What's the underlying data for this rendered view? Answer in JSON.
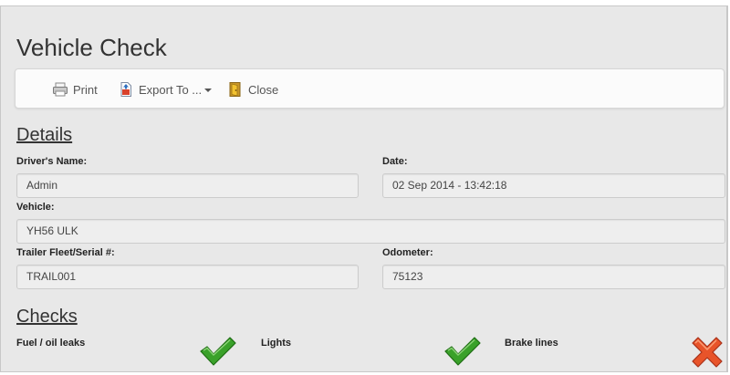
{
  "page": {
    "title": "Vehicle Check"
  },
  "toolbar": {
    "print_label": "Print",
    "export_label": "Export To ...",
    "close_label": "Close"
  },
  "details": {
    "heading": "Details",
    "driver_label": "Driver's Name:",
    "driver_value": "Admin",
    "date_label": "Date:",
    "date_value": "02 Sep 2014 - 13:42:18",
    "vehicle_label": "Vehicle:",
    "vehicle_value": "YH56 ULK",
    "trailer_label": "Trailer Fleet/Serial #:",
    "trailer_value": "TRAIL001",
    "odometer_label": "Odometer:",
    "odometer_value": "75123"
  },
  "checks": {
    "heading": "Checks",
    "items": [
      {
        "label": "Fuel / oil leaks",
        "status": "pass",
        "icon": "check-icon"
      },
      {
        "label": "Lights",
        "status": "pass",
        "icon": "check-icon"
      },
      {
        "label": "Brake lines",
        "status": "fail",
        "icon": "cross-icon"
      }
    ]
  },
  "colors": {
    "pass": "#3aa12a",
    "fail": "#e8542a"
  }
}
